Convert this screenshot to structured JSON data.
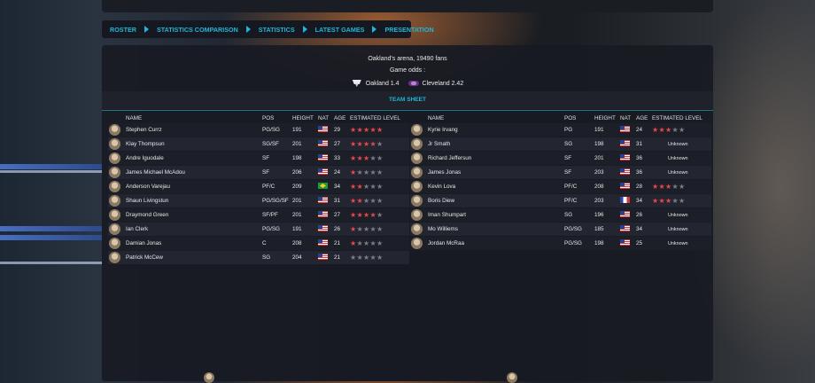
{
  "nav": [
    {
      "label": "ROSTER"
    },
    {
      "label": "STATISTICS COMPARISON"
    },
    {
      "label": "STATISTICS"
    },
    {
      "label": "LATEST GAMES"
    },
    {
      "label": "PRESENTATION"
    }
  ],
  "game": {
    "arena": "Oakland's arena, 19490 fans",
    "odds_label": "Game odds :",
    "home_odd": "Oakland 1.4",
    "away_odd": "Cleveland 2.42"
  },
  "team_sheet_title": "TEAM SHEET",
  "columns": {
    "name": "NAME",
    "pos": "POS",
    "height": "HEIGHT",
    "nat": "NAT",
    "age": "AGE",
    "level": "ESTIMATED LEVEL"
  },
  "home_players": [
    {
      "name": "Stephen Currz",
      "pos": "PG/SG",
      "height": "191",
      "nat": "us-flag",
      "age": "29",
      "stars": 5,
      "level_text": ""
    },
    {
      "name": "Klay Thompsun",
      "pos": "SG/SF",
      "height": "201",
      "nat": "us-flag",
      "age": "27",
      "stars": 4,
      "level_text": ""
    },
    {
      "name": "Andre Iguodale",
      "pos": "SF",
      "height": "198",
      "nat": "us-flag",
      "age": "33",
      "stars": 3,
      "level_text": ""
    },
    {
      "name": "James Michael McAdou",
      "pos": "SF",
      "height": "206",
      "nat": "us-flag",
      "age": "24",
      "stars": 1,
      "level_text": ""
    },
    {
      "name": "Anderson Varejau",
      "pos": "PF/C",
      "height": "209",
      "nat": "br-flag",
      "age": "34",
      "stars": 2,
      "level_text": ""
    },
    {
      "name": "Shaun Livingstun",
      "pos": "PG/SG/SF",
      "height": "201",
      "nat": "us-flag",
      "age": "31",
      "stars": 2,
      "level_text": ""
    },
    {
      "name": "Draymond Green",
      "pos": "SF/PF",
      "height": "201",
      "nat": "us-flag",
      "age": "27",
      "stars": 4,
      "level_text": ""
    },
    {
      "name": "Ian Clerk",
      "pos": "PG/SG",
      "height": "191",
      "nat": "us-flag",
      "age": "26",
      "stars": 1,
      "level_text": ""
    },
    {
      "name": "Damian Jonas",
      "pos": "C",
      "height": "208",
      "nat": "us-flag",
      "age": "21",
      "stars": 1,
      "level_text": ""
    },
    {
      "name": "Patrick McCew",
      "pos": "SG",
      "height": "204",
      "nat": "us-flag",
      "age": "21",
      "stars": 0,
      "level_text": ""
    }
  ],
  "away_players": [
    {
      "name": "Kyrie Irvang",
      "pos": "PG",
      "height": "191",
      "nat": "us-flag",
      "age": "24",
      "stars": 3,
      "level_text": ""
    },
    {
      "name": "Jr Smath",
      "pos": "SG",
      "height": "198",
      "nat": "us-flag",
      "age": "31",
      "stars": null,
      "level_text": "Unknown"
    },
    {
      "name": "Richard Jeffersun",
      "pos": "SF",
      "height": "201",
      "nat": "us-flag",
      "age": "36",
      "stars": null,
      "level_text": "Unknown"
    },
    {
      "name": "James Jonas",
      "pos": "SF",
      "height": "203",
      "nat": "us-flag",
      "age": "36",
      "stars": null,
      "level_text": "Unknown"
    },
    {
      "name": "Kevin Lova",
      "pos": "PF/C",
      "height": "208",
      "nat": "us-flag",
      "age": "28",
      "stars": 3,
      "level_text": ""
    },
    {
      "name": "Boris Diew",
      "pos": "PF/C",
      "height": "203",
      "nat": "fr-flag",
      "age": "34",
      "stars": 3,
      "level_text": ""
    },
    {
      "name": "Iman Shumpart",
      "pos": "SG",
      "height": "196",
      "nat": "us-flag",
      "age": "26",
      "stars": null,
      "level_text": "Unknown"
    },
    {
      "name": "Mo Williems",
      "pos": "PG/SG",
      "height": "185",
      "nat": "us-flag",
      "age": "34",
      "stars": null,
      "level_text": "Unknown"
    },
    {
      "name": "Jordan McRaa",
      "pos": "PG/SG",
      "height": "198",
      "nat": "us-flag",
      "age": "25",
      "stars": null,
      "level_text": "Unknown"
    }
  ],
  "colors": {
    "accent": "#22b6d6",
    "star_on": "#e5484d",
    "star_off": "#7b7e86",
    "panel": "#181b23"
  }
}
